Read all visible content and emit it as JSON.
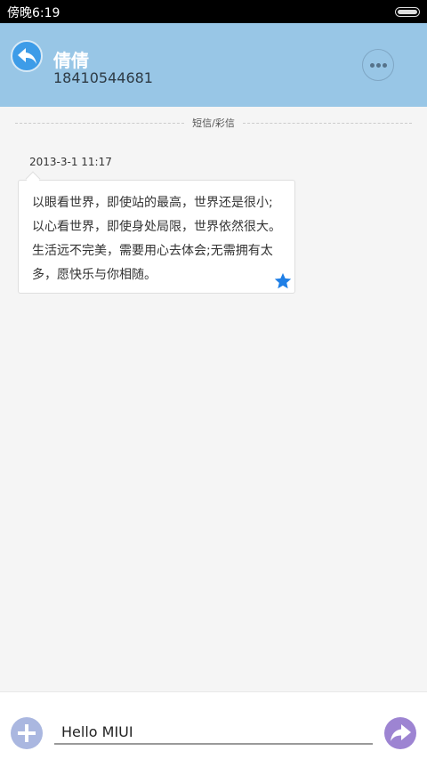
{
  "status_bar": {
    "time": "傍晚6:19"
  },
  "header": {
    "contact_name": "倩倩",
    "contact_number": "18410544681"
  },
  "divider": {
    "label": "短信/彩信"
  },
  "message": {
    "timestamp": "2013-3-1 11:17",
    "text": "以眼看世界，即使站的最高，世界还是很小;以心看世界，即使身处局限，世界依然很大。生活远不完美，需要用心去体会;无需拥有太多，愿快乐与你相随。",
    "starred": true
  },
  "composer": {
    "input_value": "Hello MIUI"
  },
  "colors": {
    "header_bg": "#98c6e6",
    "accent_blue": "#3d9ce8",
    "star": "#1f7fe6",
    "send_button": "#9d84d2",
    "add_button": "#aab7e0"
  },
  "icons": {
    "back": "back-arrow-icon",
    "more": "more-dots-icon",
    "star": "star-icon",
    "add": "plus-icon",
    "send": "send-arrow-icon"
  }
}
